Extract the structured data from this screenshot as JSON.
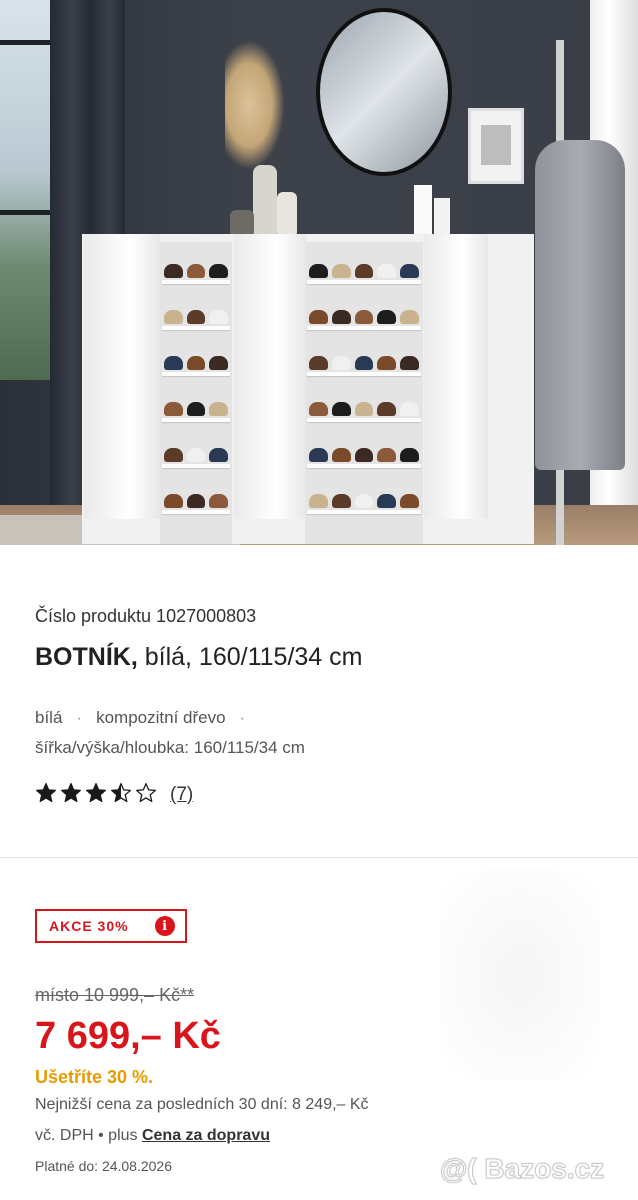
{
  "product": {
    "number_label": "Číslo produktu 1027000803",
    "title_bold": "BOTNÍK,",
    "title_rest": " bílá, 160/115/34 cm",
    "attributes": {
      "color": "bílá",
      "material": "kompozitní dřevo",
      "dimensions": "šířka/výška/hloubka: 160/115/34 cm"
    },
    "rating": {
      "value": 3.5,
      "max": 5,
      "count_label": "(7)"
    }
  },
  "pricing": {
    "badge_label": "AKCE 30%",
    "badge_info_icon": "i",
    "old_price": "místo 10 999,– Kč**",
    "price": "7 699,– Kč",
    "savings": "Ušetříte 30 %.",
    "lowest_price_note": "Nejnižší cena za posledních 30 dní: 8 249,– Kč",
    "vat_note": "vč. DPH",
    "vat_sep": " • plus ",
    "shipping_link": "Cena za dopravu",
    "valid_until": "Platné do: 24.08.2026"
  },
  "watermark": "@( Bazos.cz",
  "colors": {
    "accent_red": "#d9151c",
    "savings_orange": "#e89b00",
    "star": "#1a1a1a"
  }
}
